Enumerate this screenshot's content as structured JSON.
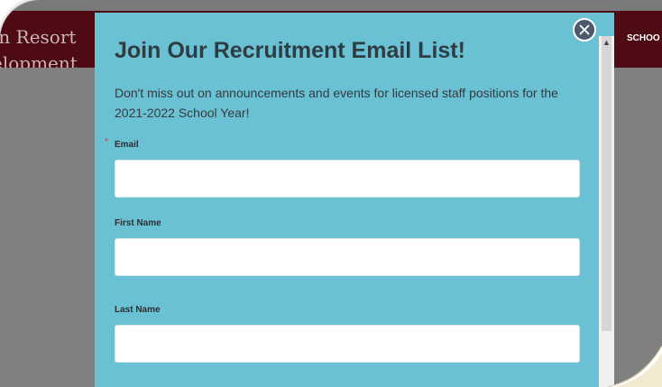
{
  "site": {
    "name_line1": "in Resort",
    "name_line2": "elopment"
  },
  "nav": {
    "item": "SCHOO"
  },
  "modal": {
    "title": "Join Our Recruitment Email List!",
    "description": "Don't miss out on announcements and events for licensed staff positions for the 2021-2022 School Year!",
    "required_mark": "*",
    "fields": [
      {
        "label": "Email",
        "required": true,
        "value": ""
      },
      {
        "label": "First Name",
        "required": false,
        "value": ""
      },
      {
        "label": "Last Name",
        "required": false,
        "value": ""
      }
    ]
  },
  "colors": {
    "header": "#4f0b14",
    "modal_bg": "#6bc1d4",
    "close_button": "#4e5a6c",
    "required": "#dd3333"
  },
  "icons": {
    "close": "close-icon",
    "scroll_up": "chevron-up-icon"
  }
}
